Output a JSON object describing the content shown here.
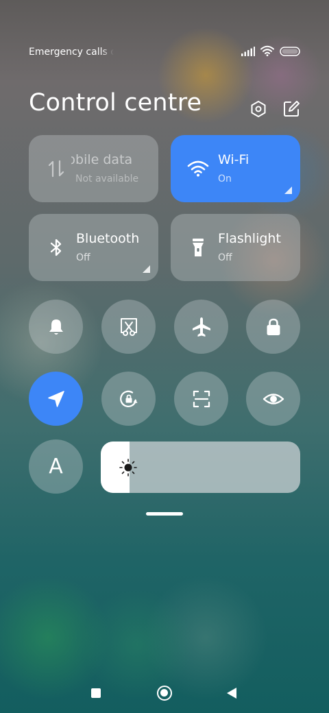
{
  "status_bar": {
    "carrier_text": "Emergency calls only",
    "icons": [
      "signal-icon",
      "wifi-icon",
      "battery-icon"
    ]
  },
  "header": {
    "title": "Control centre",
    "icons": [
      "settings-icon",
      "edit-icon"
    ]
  },
  "tiles": [
    {
      "id": "mobile-data",
      "label": "Mobile data",
      "status": "Not available",
      "active": false,
      "icon": "mobile-data-icon"
    },
    {
      "id": "wifi",
      "label": "Wi-Fi",
      "status": "On",
      "active": true,
      "icon": "wifi-icon"
    },
    {
      "id": "bluetooth",
      "label": "Bluetooth",
      "status": "Off",
      "active": false,
      "icon": "bluetooth-icon"
    },
    {
      "id": "flashlight",
      "label": "Flashlight",
      "status": "Off",
      "active": false,
      "icon": "flashlight-icon"
    }
  ],
  "toggles": [
    {
      "id": "silent",
      "icon": "bell-icon",
      "active": false
    },
    {
      "id": "screenshot",
      "icon": "screenshot-scissors-icon",
      "active": false
    },
    {
      "id": "airplane-mode",
      "icon": "airplane-icon",
      "active": false
    },
    {
      "id": "lock-screen",
      "icon": "lock-icon",
      "active": false
    },
    {
      "id": "location",
      "icon": "location-arrow-icon",
      "active": true
    },
    {
      "id": "rotation-lock",
      "icon": "rotation-lock-icon",
      "active": false
    },
    {
      "id": "scanner",
      "icon": "scan-icon",
      "active": false
    },
    {
      "id": "reading-mode",
      "icon": "eye-icon",
      "active": false
    },
    {
      "id": "auto-brightness",
      "label": "A",
      "icon": "auto-brightness-icon",
      "active": false
    }
  ],
  "brightness": {
    "level": 0.145,
    "icon": "sun-icon"
  },
  "colors": {
    "accent": "#3d86f7",
    "tile_bg": "rgba(205,212,215,0.33)"
  },
  "nav_bar": {
    "icons": [
      "recents-square-icon",
      "home-circle-icon",
      "back-triangle-icon"
    ]
  }
}
